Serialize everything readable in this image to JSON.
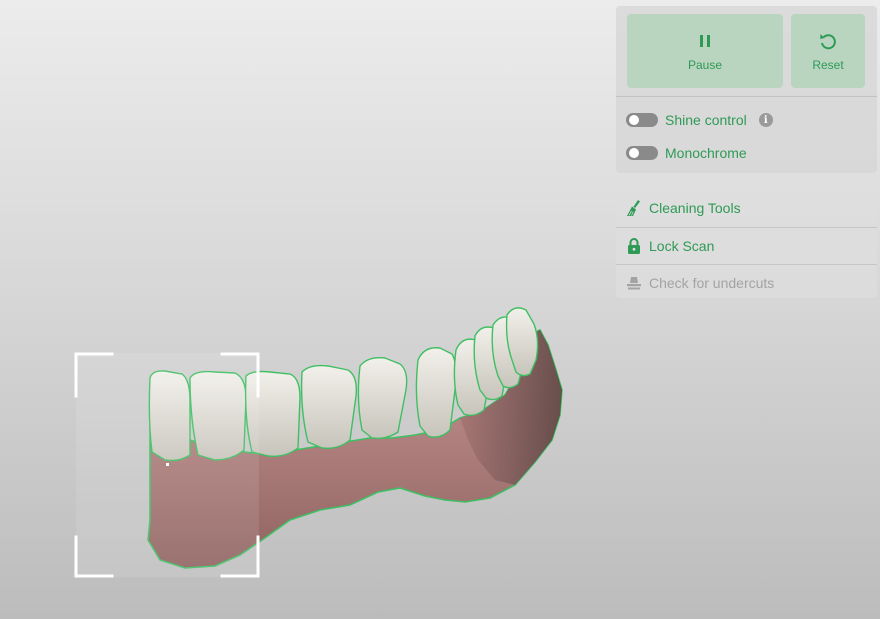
{
  "scan_controls": {
    "pause_label": "Pause",
    "reset_label": "Reset",
    "pause_icon": "pause-icon",
    "reset_icon": "reset-icon"
  },
  "view_options": {
    "shine_control": {
      "label": "Shine control",
      "enabled": false,
      "info_icon": "i"
    },
    "monochrome": {
      "label": "Monochrome",
      "enabled": false
    }
  },
  "tools": {
    "cleaning": {
      "label": "Cleaning Tools",
      "icon": "broom-icon",
      "enabled": true
    },
    "lock_scan": {
      "label": "Lock Scan",
      "icon": "lock-icon",
      "enabled": true
    },
    "undercuts": {
      "label": "Check for undercuts",
      "icon": "undercut-icon",
      "enabled": false
    }
  },
  "colors": {
    "accent": "#2f9a56",
    "button_bg": "#b9d5c0",
    "disabled_text": "#a3a3a3",
    "scan_outline": "#3fbf63"
  }
}
